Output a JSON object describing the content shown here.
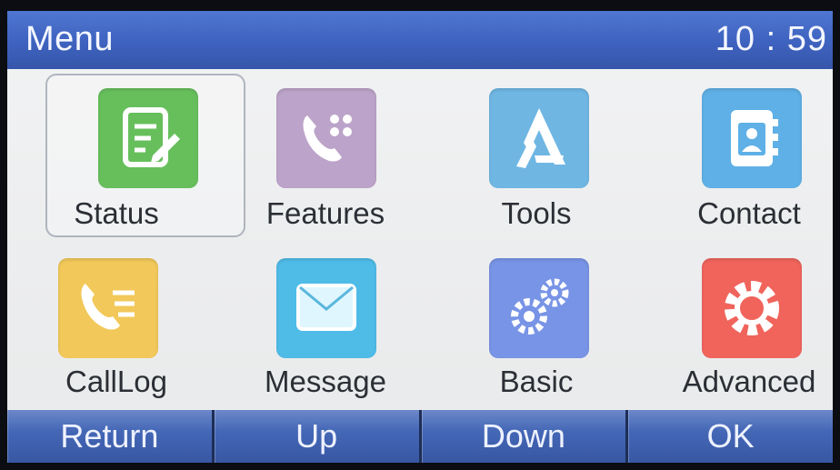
{
  "header": {
    "title": "Menu",
    "time": "10 : 59"
  },
  "menu": {
    "selected_index": 0,
    "items": [
      {
        "label": "Status",
        "icon": "status-icon",
        "color": "#67bf5c"
      },
      {
        "label": "Features",
        "icon": "features-icon",
        "color": "#bca3c9"
      },
      {
        "label": "Tools",
        "icon": "tools-icon",
        "color": "#6fb6e3"
      },
      {
        "label": "Contact",
        "icon": "contact-icon",
        "color": "#5fb0e6"
      },
      {
        "label": "CallLog",
        "icon": "calllog-icon",
        "color": "#f2c85a"
      },
      {
        "label": "Message",
        "icon": "message-icon",
        "color": "#4fbce8"
      },
      {
        "label": "Basic",
        "icon": "basic-icon",
        "color": "#7894e6"
      },
      {
        "label": "Advanced",
        "icon": "advanced-icon",
        "color": "#f0645c"
      }
    ]
  },
  "softkeys": {
    "return": "Return",
    "up": "Up",
    "down": "Down",
    "ok": "OK"
  }
}
